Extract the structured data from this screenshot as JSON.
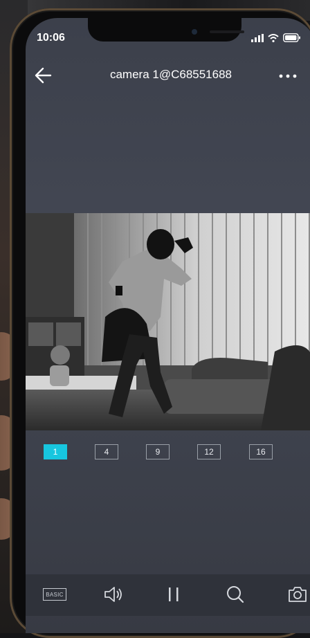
{
  "status_bar": {
    "time": "10:06"
  },
  "header": {
    "title": "camera 1@C68551688"
  },
  "layout_options": [
    "1",
    "4",
    "9",
    "12",
    "16"
  ],
  "active_layout": "1",
  "toolbar": {
    "basic_label": "BASIC"
  },
  "icons": {
    "back": "arrow-left-icon",
    "more": "more-dots-icon",
    "signal": "signal-icon",
    "wifi": "wifi-icon",
    "battery": "battery-icon",
    "volume": "speaker-icon",
    "pause": "pause-icon",
    "zoom": "magnifier-icon",
    "snapshot": "camera-icon"
  },
  "colors": {
    "accent": "#17c6df",
    "screen_bg": "#3f434e",
    "toolbar_bg": "#2f323a"
  }
}
